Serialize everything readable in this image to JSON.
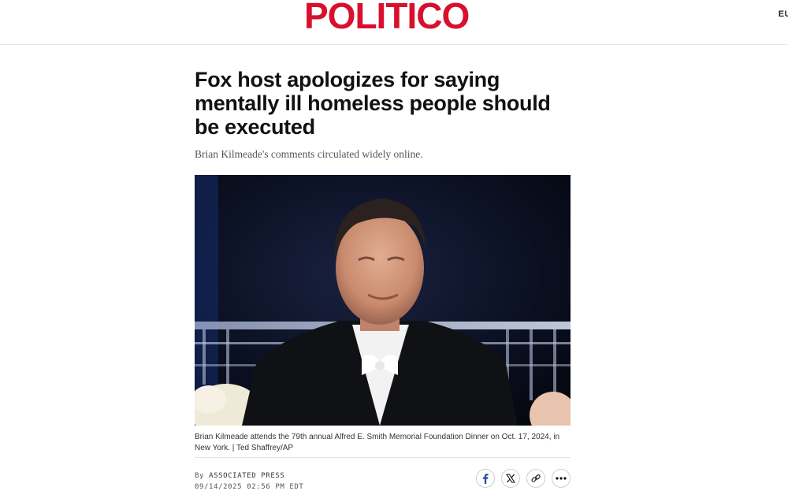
{
  "header": {
    "logo_text": "POLITICO",
    "edition_label": "EU",
    "brand_color": "#d8102e"
  },
  "article": {
    "headline": "Fox host apologizes for saying mentally ill homeless people should be executed",
    "dek": "Brian Kilmeade's comments circulated widely online."
  },
  "photo": {
    "caption": "Brian Kilmeade attends the 79th annual Alfred E. Smith Memorial Foundation Dinner on Oct. 17, 2024, in New York. | Ted Shaffrey/AP"
  },
  "byline": {
    "prefix": "By",
    "author": "ASSOCIATED PRESS",
    "timestamp": "09/14/2025 02:56 PM EDT"
  },
  "share": {
    "buttons": [
      {
        "icon": "facebook-icon"
      },
      {
        "icon": "x-icon"
      },
      {
        "icon": "link-icon"
      },
      {
        "icon": "more-icon"
      }
    ]
  }
}
